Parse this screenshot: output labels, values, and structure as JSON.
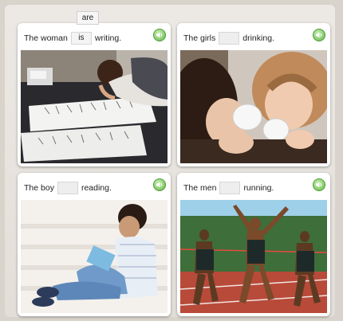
{
  "cards": [
    {
      "before": "The woman",
      "after": "writing.",
      "blank": "is"
    },
    {
      "before": "The girls",
      "after": "drinking.",
      "blank": ""
    },
    {
      "before": "The boy",
      "after": "reading.",
      "blank": ""
    },
    {
      "before": "The men",
      "after": "running.",
      "blank": ""
    }
  ],
  "options": [
    "are"
  ],
  "colors": {
    "audio_button": "#66b84a",
    "card_bg": "#ffffff",
    "frame_bg": "#e9e6e1"
  },
  "icons": {
    "audio": "speaker-icon"
  }
}
